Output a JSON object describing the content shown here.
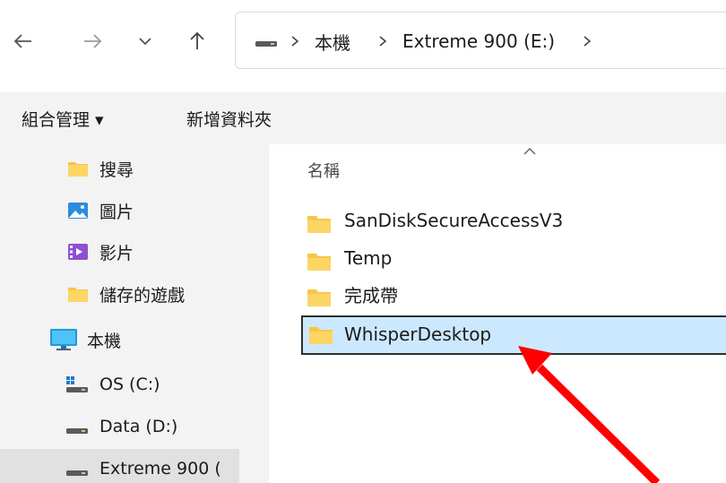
{
  "window": {
    "nav": {
      "back_icon": "arrow-left-icon",
      "forward_icon": "arrow-right-icon",
      "recent_icon": "chevron-down-icon",
      "up_icon": "arrow-up-icon"
    },
    "address_bar": {
      "icon": "drive-icon",
      "crumbs": [
        "本機",
        "Extreme 900 (E:)"
      ],
      "separator_icon": "chevron-right-icon"
    }
  },
  "command_bar": {
    "organize_label": "組合管理 ▾",
    "new_folder_label": "新增資料夾"
  },
  "sidebar": {
    "items": [
      {
        "label": "搜尋",
        "icon": "folder-icon"
      },
      {
        "label": "圖片",
        "icon": "pictures-icon"
      },
      {
        "label": "影片",
        "icon": "videos-icon"
      },
      {
        "label": "儲存的遊戲",
        "icon": "folder-icon"
      },
      {
        "label": "本機",
        "icon": "computer-icon"
      },
      {
        "label": "OS (C:)",
        "icon": "windows-drive-icon"
      },
      {
        "label": "Data (D:)",
        "icon": "drive-icon"
      },
      {
        "label": "Extreme 900 (",
        "icon": "drive-icon",
        "selected": true
      }
    ]
  },
  "file_list": {
    "column_name": "名稱",
    "sort_icon": "sort-up-icon",
    "files": [
      {
        "name": "SanDiskSecureAccessV3",
        "icon": "folder-icon"
      },
      {
        "name": "Temp",
        "icon": "folder-icon"
      },
      {
        "name": "完成帶",
        "icon": "folder-icon"
      },
      {
        "name": "WhisperDesktop",
        "icon": "folder-icon",
        "selected": true
      }
    ]
  },
  "annotation": {
    "arrow_color": "#ff0000",
    "points_to": "WhisperDesktop"
  },
  "colors": {
    "selection_bg": "#cce8ff",
    "folder": "#f8c646",
    "pane_bg": "#f3f3f3"
  }
}
